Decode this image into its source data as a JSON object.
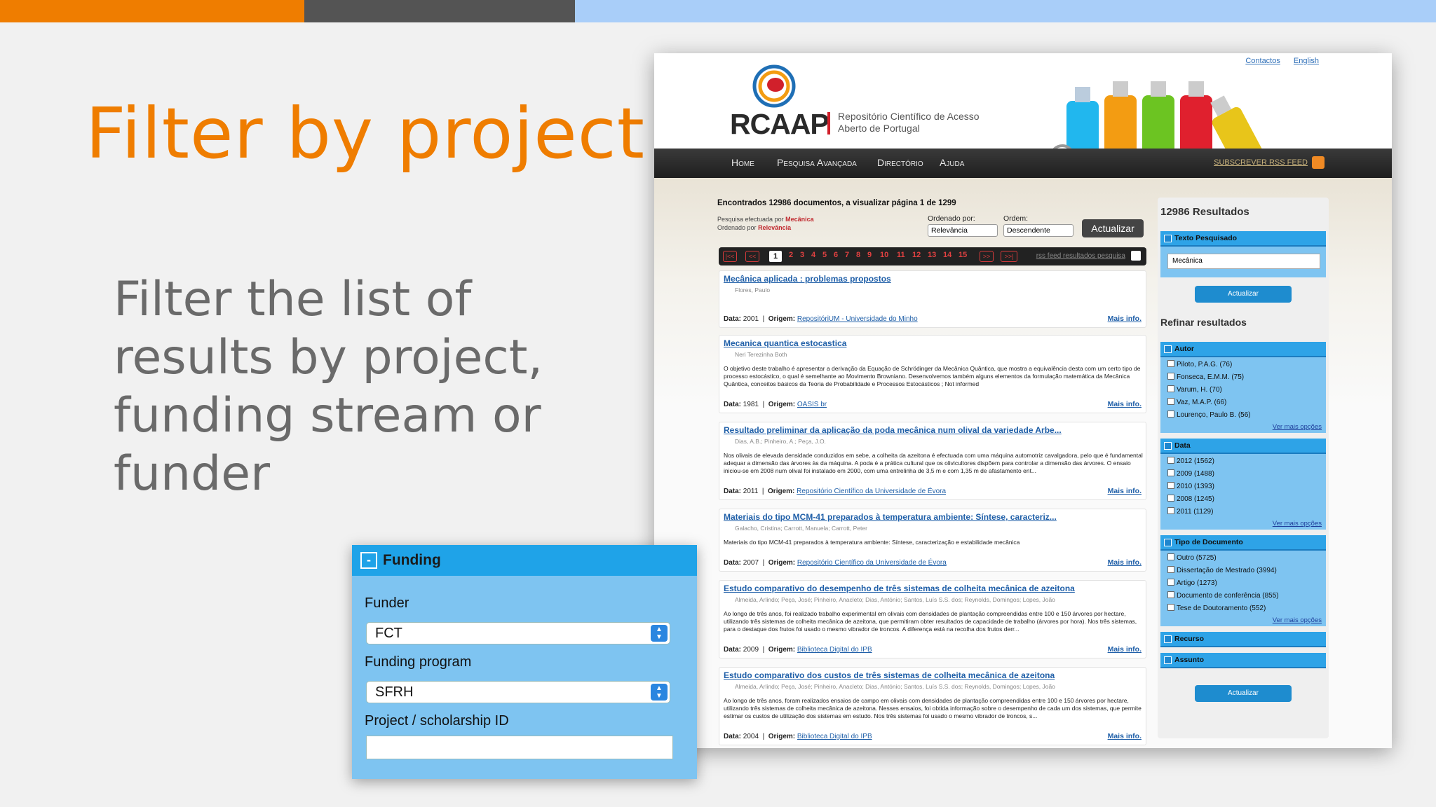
{
  "slide": {
    "title": "Filter by project",
    "body": "Filter the list of results by project, funding stream or funder"
  },
  "header": {
    "links": [
      "Contactos",
      "English"
    ],
    "logo_text": "RCAAP",
    "logo_sub": "Repositório Científico de Acesso Aberto de Portugal"
  },
  "nav": {
    "items": [
      "Home",
      "Pesquisa Avançada",
      "Directório",
      "Ajuda"
    ],
    "rss": "SUBSCREVER RSS FEED"
  },
  "results": {
    "summary": "Encontrados 12986 documentos, a visualizar página 1 de 1299",
    "meta_search_prefix": "Pesquisa efectuada por",
    "meta_search_term": "Mecânica",
    "meta_order_prefix": "Ordenado por",
    "meta_order_term": "Relevância",
    "sort_by_label": "Ordenado por:",
    "sort_by_value": "Relevância",
    "order_label": "Ordem:",
    "order_value": "Descendente",
    "update_button": "Actualizar",
    "pager": {
      "first": "|<<",
      "prev": "<<",
      "pages": [
        "1",
        "2",
        "3",
        "4",
        "5",
        "6",
        "7",
        "8",
        "9",
        "10",
        "11",
        "12",
        "13",
        "14",
        "15"
      ],
      "next": ">>",
      "last": ">>|",
      "rss_label": "rss feed resultados pesquisa"
    },
    "data_label": "Data:",
    "origem_label": "Origem:",
    "more_label": "Mais info.",
    "items": [
      {
        "title": "Mecânica aplicada : problemas propostos",
        "authors": "Flores, Paulo",
        "abstract": "",
        "date": "2001",
        "origin": "RepositóriUM - Universidade do Minho"
      },
      {
        "title": "Mecanica quantica estocastica",
        "authors": "Neri Terezinha Both",
        "abstract": "O objetivo deste trabalho é apresentar a derivação da Equação de Schrödinger da Mecânica Quântica, que mostra a equivalência desta com um certo tipo de processo estocástico, o qual é semelhante ao Movimento Browniano. Desenvolvemos também alguns elementos da formulação matemática da Mecânica Quântica, conceitos básicos da Teoria de Probabilidade e Processos Estocásticos ; Not informed",
        "date": "1981",
        "origin": "OASIS br"
      },
      {
        "title": "Resultado preliminar da aplicação da poda mecânica num olival da variedade Arbe...",
        "authors": "Dias, A.B.; Pinheiro, A.; Peça, J.O.",
        "abstract": "Nos olivais de elevada densidade conduzidos em sebe, a colheita da azeitona é efectuada com uma máquina automotriz cavalgadora, pelo que é fundamental adequar a dimensão das árvores às da máquina. A poda é a prática cultural que os olivicultores dispõem para controlar a dimensão das árvores. O ensaio iniciou-se em 2008 num olival foi instalado em 2000, com uma entrelinha de 3,5 m e com 1,35 m de afastamento ent...",
        "date": "2011",
        "origin": "Repositório Científico da Universidade de Évora"
      },
      {
        "title": "Materiais do tipo MCM-41 preparados à temperatura ambiente: Síntese, caracteriz...",
        "authors": "Galacho, Cristina; Carrott, Manuela; Carrott, Peter",
        "abstract": "Materiais do tipo MCM-41 preparados à temperatura ambiente: Síntese, caracterização e estabilidade mecânica",
        "date": "2007",
        "origin": "Repositório Científico da Universidade de Évora"
      },
      {
        "title": "Estudo comparativo do desempenho de três sistemas de colheita mecânica de azeitona",
        "authors": "Almeida, Arlindo; Peça, José; Pinheiro, Anacleto; Dias, António; Santos, Luís S.S. dos; Reynolds, Domingos; Lopes, João",
        "abstract": "Ao longo de três anos, foi realizado trabalho experimental em olivais com densidades de plantação compreendidas entre 100 e 150 árvores por hectare, utilizando três sistemas de colheita mecânica de azeitona, que permitiram obter resultados de capacidade de trabalho (árvores por hora). Nos três sistemas, para o destaque dos frutos foi usado o mesmo vibrador de troncos. A diferença está na recolha dos frutos derr...",
        "date": "2009",
        "origin": "Biblioteca Digital do IPB"
      },
      {
        "title": "Estudo comparativo dos custos de três sistemas de colheita mecânica de azeitona",
        "authors": "Almeida, Arlindo; Peça, José; Pinheiro, Anacleto; Dias, António; Santos, Luís S.S. dos; Reynolds, Domingos; Lopes, João",
        "abstract": "Ao longo de três anos, foram realizados ensaios de campo em olivais com densidades de plantação compreendidas entre 100 e 150 árvores por hectare, utilizando três sistemas de colheita mecânica de azeitona. Nesses ensaios, foi obtida informação sobre o desempenho de cada um dos sistemas, que permite estimar os custos de utilização dos sistemas em estudo. Nos três sistemas foi usado o mesmo vibrador de troncos, s...",
        "date": "2004",
        "origin": "Biblioteca Digital do IPB"
      }
    ]
  },
  "sidebar": {
    "total": "12986 Resultados",
    "texto_header": "Texto Pesquisado",
    "texto_value": "Mecânica",
    "update_button": "Actualizar",
    "refine_title": "Refinar resultados",
    "more_options": "Ver mais opções",
    "autor_header": "Autor",
    "autor_items": [
      "Piloto, P.A.G. (76)",
      "Fonseca, E.M.M. (75)",
      "Varum, H. (70)",
      "Vaz, M.A.P. (66)",
      "Lourenço, Paulo B. (56)"
    ],
    "data_header": "Data",
    "data_items": [
      "2012 (1562)",
      "2009 (1488)",
      "2010 (1393)",
      "2008 (1245)",
      "2011 (1129)"
    ],
    "tipo_header": "Tipo de Documento",
    "tipo_items": [
      "Outro (5725)",
      "Dissertação de Mestrado (3994)",
      "Artigo (1273)",
      "Documento de conferência (855)",
      "Tese de Doutoramento (552)"
    ],
    "recurso_header": "Recurso",
    "assunto_header": "Assunto"
  },
  "funding": {
    "toggle": "-",
    "title": "Funding",
    "funder_label": "Funder",
    "funder_value": "FCT",
    "program_label": "Funding program",
    "program_value": "SFRH",
    "project_label": "Project / scholarship ID",
    "project_value": ""
  },
  "colors": {
    "accent_orange": "#ef7d00",
    "blue_panel": "#7ec4f1",
    "blue_header": "#1fa3e8"
  }
}
